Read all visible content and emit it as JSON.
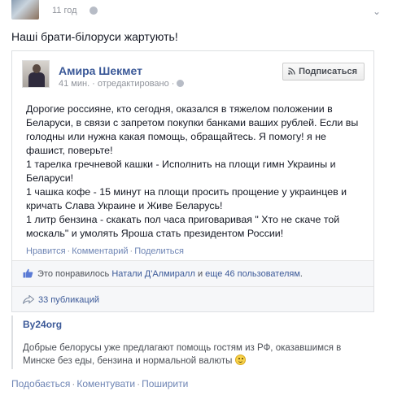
{
  "post": {
    "timestamp": "11 год",
    "text": "Наші брати-білоруси жартують!",
    "actions": {
      "like": "Подобається",
      "comment": "Коментувати",
      "share": "Поширити"
    }
  },
  "shared_post": {
    "author": "Амира Шекмет",
    "meta": "41 мин. · отредактировано ·",
    "subscribe_label": "Подписаться",
    "body_lines": [
      "Дорогие россияне, кто сегодня, оказался в тяжелом положении в",
      "Беларуси, в связи с запретом покупки банками ваших рублей. Если вы",
      "голодны или нужна какая помощь, обращайтесь. Я помогу! я не",
      "фашист, поверьте!",
      "1 тарелка гречневой кашки - Исполнить на площи гимн Украины и",
      "Беларуси!",
      "1 чашка кофе - 15 минут на площи просить прощение у украинцев и",
      "кричать Слава Украине и Живе Беларусь!",
      "1 литр бензина - скакать пол часа приговаривая \" Хто не скаче той",
      "москаль\" и умолять Яроша стать президентом России!"
    ],
    "actions": {
      "like": "Нравится",
      "comment": "Комментарий",
      "share": "Поделиться"
    },
    "likes": {
      "prefix": "Это понравилось",
      "person": "Натали Д'Алмиралл",
      "and": "и",
      "others": "еще 46 пользователям",
      "suffix": "."
    },
    "shares": "33 публикаций"
  },
  "source": {
    "name": "By24org",
    "description": "Добрые белорусы уже предлагают помощь гостям из РФ, оказавшимся в Минске без еды, бензина и нормальной валюты"
  },
  "colors": {
    "link": "#3b5998",
    "action_link": "#6d84b4",
    "meta": "#90949c",
    "text": "#141823"
  },
  "icons": [
    "globe-icon",
    "chevron-down-icon",
    "rss-icon",
    "like-thumb-icon",
    "share-arrow-icon",
    "smiley-icon"
  ]
}
